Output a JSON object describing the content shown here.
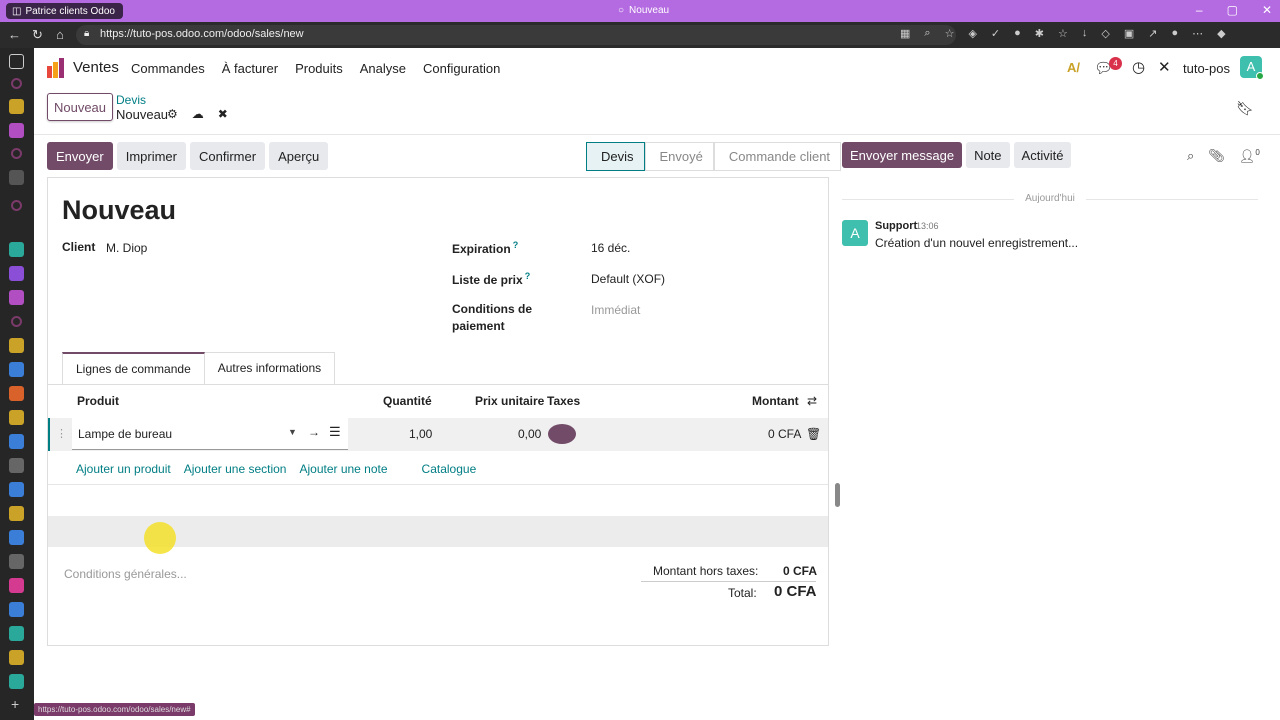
{
  "browser": {
    "profile": "Patrice clients Odoo",
    "tab_title": "Nouveau",
    "url": "https://tuto-pos.odoo.com/odoo/sales/new",
    "status_url": "https://tuto-pos.odoo.com/odoo/sales/new#"
  },
  "nav": {
    "app": "Ventes",
    "menu": [
      "Commandes",
      "À facturer",
      "Produits",
      "Analyse",
      "Configuration"
    ],
    "messages_badge": "4",
    "company": "tuto-pos",
    "avatar_letter": "A"
  },
  "breadcrumb": {
    "new_button": "Nouveau",
    "parent": "Devis",
    "current": "Nouveau"
  },
  "actions": [
    "Envoyer",
    "Imprimer",
    "Confirmer",
    "Aperçu"
  ],
  "stages": [
    "Devis",
    "Envoyé",
    "Commande client"
  ],
  "chatter_actions": [
    "Envoyer message",
    "Note",
    "Activité"
  ],
  "followers_count": "0",
  "form": {
    "title": "Nouveau",
    "client_label": "Client",
    "client_value": "M. Diop",
    "expiration_label": "Expiration",
    "expiration_value": "16 déc.",
    "pricelist_label": "Liste de prix",
    "pricelist_value": "Default (XOF)",
    "payment_label_1": "Conditions de",
    "payment_label_2": "paiement",
    "payment_value": "Immédiat",
    "help_mark": "?"
  },
  "tabs": [
    "Lignes de commande",
    "Autres informations"
  ],
  "table": {
    "headers": {
      "product": "Produit",
      "qty": "Quantité",
      "price": "Prix unitaire",
      "taxes": "Taxes",
      "amount": "Montant"
    },
    "row": {
      "product": "Lampe de bureau",
      "qty": "1,00",
      "price": "0,00",
      "amount": "0 CFA"
    }
  },
  "add_links": [
    "Ajouter un produit",
    "Ajouter une section",
    "Ajouter une note",
    "Catalogue"
  ],
  "terms_placeholder": "Conditions générales...",
  "totals": {
    "untaxed_label": "Montant hors taxes:",
    "untaxed_value": "0 CFA",
    "total_label": "Total:",
    "total_value": "0 CFA"
  },
  "chatter": {
    "today": "Aujourd'hui",
    "avatar": "A",
    "author": "Support",
    "time": "13:06",
    "body": "Création d'un nouvel enregistrement..."
  },
  "colors": {
    "primary": "#714b67",
    "teal": "#017e84",
    "titlebar": "#b46ae0"
  }
}
